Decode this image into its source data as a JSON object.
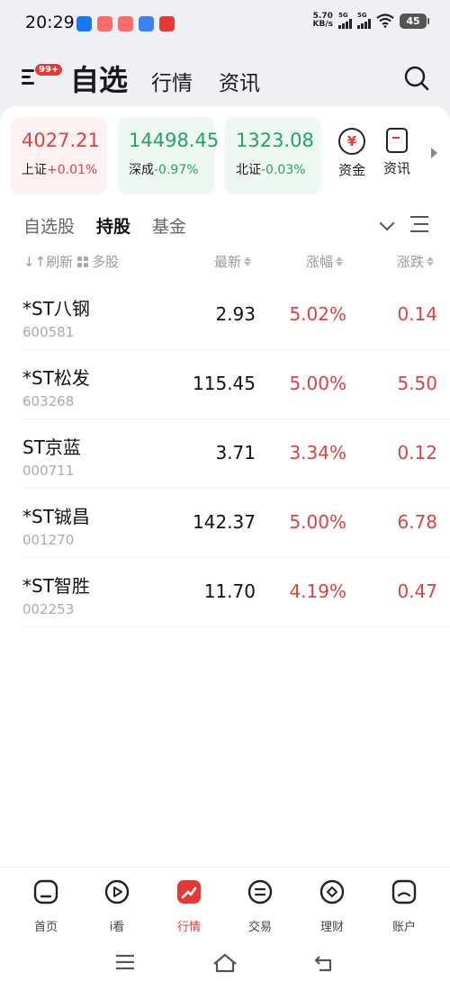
{
  "status_bar": {
    "time": "20:29",
    "net_speed_value": "5.70",
    "net_speed_unit": "KB/s",
    "signal_1": "5G",
    "signal_2": "5G",
    "battery": "45"
  },
  "header": {
    "badge": "99+",
    "tabs": [
      "自选",
      "行情",
      "资讯"
    ]
  },
  "indices": [
    {
      "value": "4027.21",
      "name": "上证",
      "change": "+0.01%",
      "trend": "up"
    },
    {
      "value": "14498.45",
      "name": "深成",
      "change": "-0.97%",
      "trend": "down"
    },
    {
      "value": "1323.08",
      "name": "北证",
      "change": "-0.03%",
      "trend": "down"
    }
  ],
  "quick_links": [
    {
      "label": "资金",
      "icon": "yuan-circle-icon",
      "glyph": "¥"
    },
    {
      "label": "资讯",
      "icon": "news-doc-icon"
    }
  ],
  "sub_tabs": [
    {
      "label": "自选股",
      "active": false
    },
    {
      "label": "持股",
      "active": true
    },
    {
      "label": "基金",
      "active": false
    }
  ],
  "columns": {
    "refresh": "刷新",
    "multi": "多股",
    "latest": "最新",
    "pct": "涨幅",
    "change": "涨跌"
  },
  "stocks": [
    {
      "name": "*ST八钢",
      "code": "600581",
      "price": "2.93",
      "pct": "5.02%",
      "change": "0.14"
    },
    {
      "name": "*ST松发",
      "code": "603268",
      "price": "115.45",
      "pct": "5.00%",
      "change": "5.50"
    },
    {
      "name": "ST京蓝",
      "code": "000711",
      "price": "3.71",
      "pct": "3.34%",
      "change": "0.12"
    },
    {
      "name": "*ST铖昌",
      "code": "001270",
      "price": "142.37",
      "pct": "5.00%",
      "change": "6.78"
    },
    {
      "name": "*ST智胜",
      "code": "002253",
      "price": "11.70",
      "pct": "4.19%",
      "change": "0.47"
    }
  ],
  "bottom_nav": [
    {
      "label": "首页",
      "icon": "home-icon",
      "active": false
    },
    {
      "label": "i看",
      "icon": "play-icon",
      "active": false
    },
    {
      "label": "行情",
      "icon": "market-chart-icon",
      "active": true
    },
    {
      "label": "交易",
      "icon": "exchange-icon",
      "active": false
    },
    {
      "label": "理财",
      "icon": "wealth-icon",
      "active": false
    },
    {
      "label": "账户",
      "icon": "account-icon",
      "active": false
    }
  ],
  "colors": {
    "up": "#d94343",
    "down": "#26a06a",
    "accent": "#e53935"
  }
}
